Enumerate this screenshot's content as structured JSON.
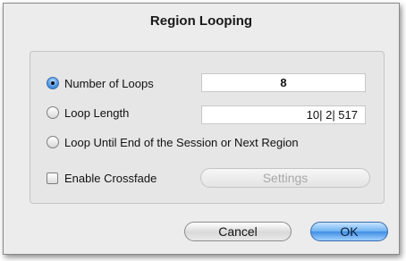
{
  "dialog": {
    "title": "Region Looping"
  },
  "options": {
    "number_of_loops": {
      "label": "Number of Loops",
      "selected": true,
      "value": "8"
    },
    "loop_length": {
      "label": "Loop Length",
      "selected": false,
      "value": "10| 2| 517"
    },
    "loop_until_end": {
      "label": "Loop Until End of the Session or Next Region",
      "selected": false
    },
    "crossfade": {
      "label": "Enable Crossfade",
      "checked": false,
      "settings_label": "Settings"
    }
  },
  "buttons": {
    "cancel": "Cancel",
    "ok": "OK"
  },
  "colors": {
    "accent": "#4f94e3",
    "dialog_bg": "#ececec"
  }
}
